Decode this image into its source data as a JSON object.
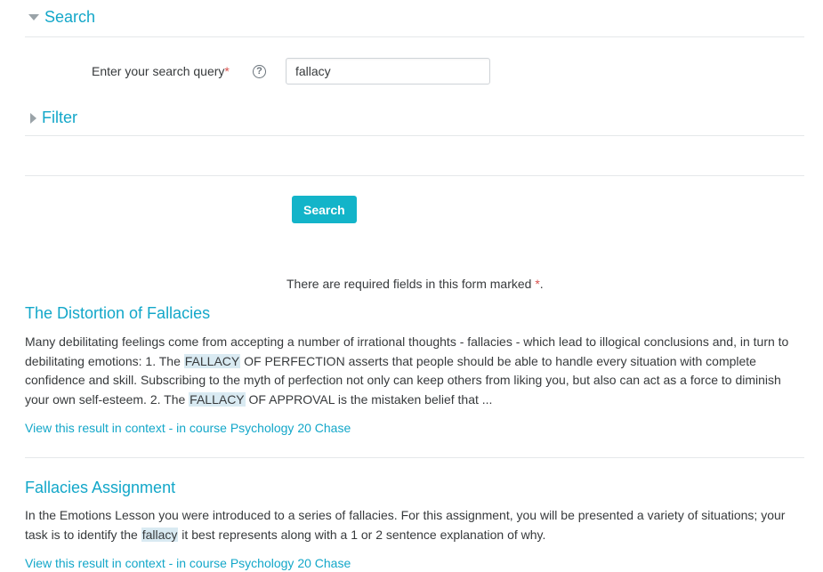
{
  "search_section": {
    "title": "Search",
    "query_label": "Enter your search query",
    "required_mark": "*",
    "help_icon": "question-circle-icon",
    "query_value": "fallacy"
  },
  "filter_section": {
    "title": "Filter"
  },
  "submit_label": "Search",
  "required_note": {
    "text": "There are required fields in this form marked",
    "mark": "*",
    "end": "."
  },
  "results": [
    {
      "title": "The Distortion of Fallacies",
      "snippet_parts": [
        "Many debilitating feelings come from accepting a number of irrational thoughts  - fallacies  - which lead to illogical conclusions and, in turn to debilitating emotions: 1.  The ",
        "FALLACY",
        " OF PERFECTION asserts that people should be able to handle every situation with complete confidence and skill. Subscribing to the myth of perfection not only can keep others from liking you, but also can act as a force to diminish your own self-esteem.  2.  The ",
        "FALLACY",
        " OF APPROVAL is the mistaken belief that ..."
      ],
      "context_link": "View this result in context - in course Psychology 20 Chase"
    },
    {
      "title": "Fallacies Assignment",
      "snippet_parts": [
        "In the Emotions Lesson you were introduced to a series of fallacies.  For this assignment, you will be presented a variety of situations; your task is to identify the ",
        "fallacy",
        " it best represents along with a 1 or 2 sentence explanation of why."
      ],
      "context_link": "View this result in context - in course Psychology 20 Chase"
    }
  ],
  "colors": {
    "accent": "#13a7c9",
    "button": "#13b4c9",
    "required": "#d9534f",
    "highlight": "#d9eaf2"
  }
}
